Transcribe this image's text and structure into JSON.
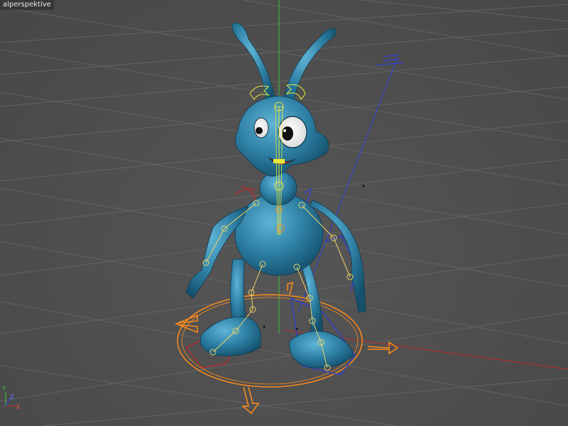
{
  "viewport": {
    "title": "Zentralperspektive",
    "visible_title": "alperspektive"
  },
  "axis_gizmo": {
    "y_label": "Y",
    "z_label": "Z",
    "x_label": "X"
  },
  "colors": {
    "background": "#505050",
    "grid": "#6a6a6a",
    "character_body": "#2c7fa3",
    "x_axis": "#c0292b",
    "y_axis": "#3ac13a",
    "z_axis": "#2c3fd8",
    "ik_control": "#ff8c1a",
    "head_control": "#e8e83c",
    "joint_marker": "#f0d46a"
  },
  "scene": {
    "object": "alien-character",
    "mode": "character-rig-view"
  }
}
